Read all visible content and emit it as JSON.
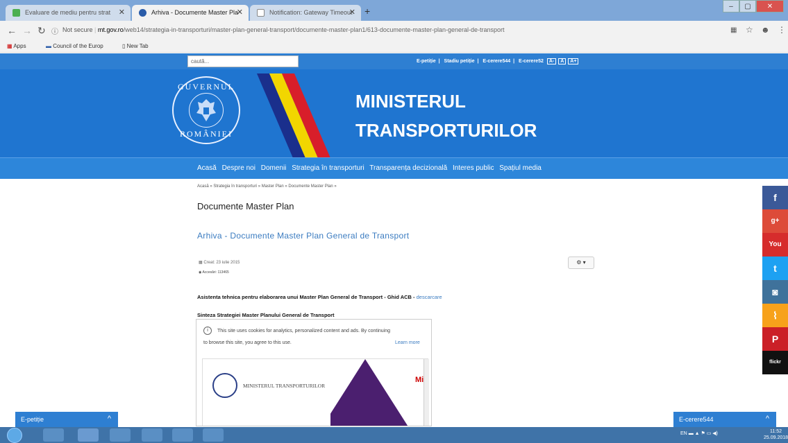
{
  "browser": {
    "tabs": [
      {
        "title": "Evaluare de mediu pentru strat",
        "active": false
      },
      {
        "title": "Arhiva - Documente Master Pla",
        "active": true
      },
      {
        "title": "Notification: Gateway Timeout",
        "active": false
      }
    ],
    "new_tab": "+",
    "url_security": "Not secure",
    "url_domain": "mt.gov.ro",
    "url_path": "/web14/strategia-in-transporturi/master-plan-general-transport/documente-master-plan1/613-documente-master-plan-general-de-transport",
    "bookmarks": [
      "Apps",
      "Council of the Europ",
      "New Tab"
    ]
  },
  "site": {
    "search_placeholder": "caută...",
    "top_links": [
      "E-petiție",
      "Stadiu petiție",
      "E-cerere544",
      "E-cerere52"
    ],
    "font_sizes": [
      "A-",
      "A",
      "A+"
    ],
    "seal_top": "GUVERNUL",
    "seal_bottom": "ROMÂNIEI",
    "title_line1": "MINISTERUL",
    "title_line2": "TRANSPORTURILOR",
    "nav": [
      "Acasă",
      "Despre noi",
      "Domenii",
      "Strategia în transporturi",
      "Transparența decizională",
      "Interes public",
      "Spațiul media"
    ],
    "breadcrumb": "Acasă  »  Strategia în transporturi  »  Master Plan  »  Documente Master Plan  »",
    "page_title": "Documente Master Plan",
    "article_title": "Arhiva - Documente Master Plan General de Transport",
    "created": "Creat: 23 iulie 2015",
    "hits": "Accesări: 113465",
    "gear_label": "⚙ ▾",
    "line1_text": "Asistenta tehnica pentru elaborarea unui Master Plan General de Transport - Ghid ACB - ",
    "line1_link": "descarcare",
    "line2_text": "Sinteza Strategiei Master Planului General de Transport",
    "cookie_line1": "This site uses cookies for analytics, personalized content and ads. By continuing",
    "cookie_line2": "to browse this site, you agree to this use.",
    "cookie_learn": "Learn more",
    "slide_ministry": "MINISTERUL TRANSPORTURILOR",
    "slide_mi": "Mi"
  },
  "social": [
    {
      "icon": "facebook-icon",
      "glyph": "f",
      "color": "#3b5998"
    },
    {
      "icon": "google-plus-icon",
      "glyph": "g+",
      "color": "#dd4b39"
    },
    {
      "icon": "youtube-icon",
      "glyph": "You",
      "color": "#d62c2c"
    },
    {
      "icon": "twitter-icon",
      "glyph": "t",
      "color": "#1da1f2"
    },
    {
      "icon": "instagram-icon",
      "glyph": "◙",
      "color": "#3f729b"
    },
    {
      "icon": "rss-icon",
      "glyph": "⌇",
      "color": "#f7a21b"
    },
    {
      "icon": "pinterest-icon",
      "glyph": "P",
      "color": "#cb2027"
    },
    {
      "icon": "flickr-icon",
      "glyph": "flickr",
      "color": "#111111"
    }
  ],
  "chat": {
    "left": "E-petiție",
    "right": "E-cerere544",
    "chevron": "^"
  },
  "taskbar": {
    "tray": "EN",
    "time": "11:52",
    "date": "25.09.2018"
  }
}
